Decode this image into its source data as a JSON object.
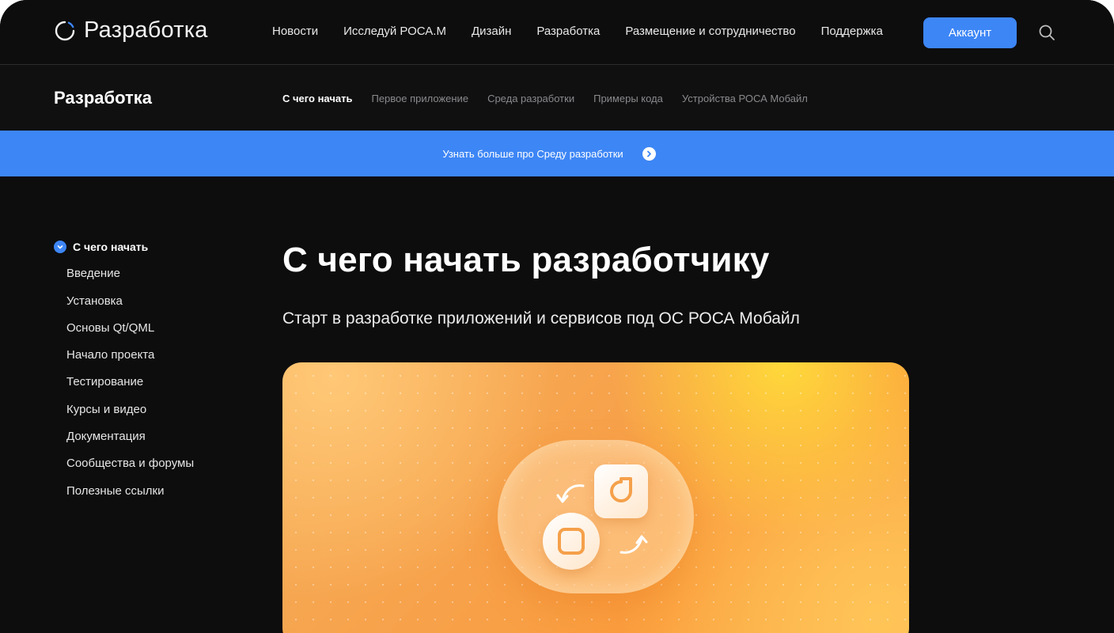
{
  "header": {
    "logo_text": "Разработка",
    "nav": [
      "Новости",
      "Исследуй РОСА.М",
      "Дизайн",
      "Разработка",
      "Размещение и сотрудничество",
      "Поддержка"
    ],
    "account_label": "Аккаунт",
    "accent_color": "#3d86f5"
  },
  "subheader": {
    "title": "Разработка",
    "tabs": [
      "С чего начать",
      "Первое приложение",
      "Среда разработки",
      "Примеры кода",
      "Устройства РОСА Мобайл"
    ],
    "active_tab": "С чего начать"
  },
  "banner": {
    "text": "Узнать больше про Среду разработки"
  },
  "sidebar": {
    "heading": "С чего начать",
    "items": [
      "Введение",
      "Установка",
      "Основы Qt/QML",
      "Начало проекта",
      "Тестирование",
      "Курсы и видео",
      "Документация",
      "Сообщества и форумы",
      "Полезные ссылки"
    ]
  },
  "main": {
    "title": "С чего начать разработчику",
    "subtitle": "Старт в разработке приложений и сервисов под ОС РОСА Мобайл"
  },
  "icons": [
    "logo-icon",
    "search-icon",
    "chevron-right-icon",
    "check-icon",
    "swap-arrow-icon",
    "app-icon-rounded",
    "app-icon-circle"
  ]
}
